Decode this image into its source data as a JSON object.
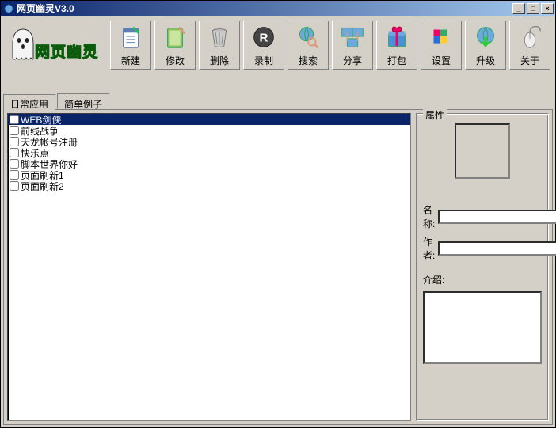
{
  "window": {
    "title": "网页幽灵V3.0"
  },
  "logo": {
    "text": "网页幽灵"
  },
  "toolbar": [
    {
      "id": "new",
      "label": "新建",
      "icon": "notepad"
    },
    {
      "id": "edit",
      "label": "修改",
      "icon": "book"
    },
    {
      "id": "delete",
      "label": "删除",
      "icon": "trash"
    },
    {
      "id": "record",
      "label": "录制",
      "icon": "letter-r"
    },
    {
      "id": "search",
      "label": "搜索",
      "icon": "globe-search"
    },
    {
      "id": "share",
      "label": "分享",
      "icon": "screens"
    },
    {
      "id": "pack",
      "label": "打包",
      "icon": "giftbox"
    },
    {
      "id": "settings",
      "label": "设置",
      "icon": "tetris"
    },
    {
      "id": "upgrade",
      "label": "升级",
      "icon": "globe-up"
    },
    {
      "id": "about",
      "label": "关于",
      "icon": "mouse"
    }
  ],
  "tabs": [
    {
      "id": "daily",
      "label": "日常应用",
      "active": false
    },
    {
      "id": "simple",
      "label": "简单例子",
      "active": true
    }
  ],
  "list": [
    {
      "label": "WEB剑侠",
      "checked": false,
      "selected": true
    },
    {
      "label": "前线战争",
      "checked": false,
      "selected": false
    },
    {
      "label": "天龙帐号注册",
      "checked": false,
      "selected": false
    },
    {
      "label": "快乐点",
      "checked": false,
      "selected": false
    },
    {
      "label": "脚本世界你好",
      "checked": false,
      "selected": false
    },
    {
      "label": "页面刷新1",
      "checked": false,
      "selected": false
    },
    {
      "label": "页面刷新2",
      "checked": false,
      "selected": false
    }
  ],
  "properties": {
    "panel_title": "属性",
    "name_label": "名称:",
    "name_value": "",
    "author_label": "作者:",
    "author_value": "",
    "intro_label": "介绍:",
    "intro_value": ""
  }
}
